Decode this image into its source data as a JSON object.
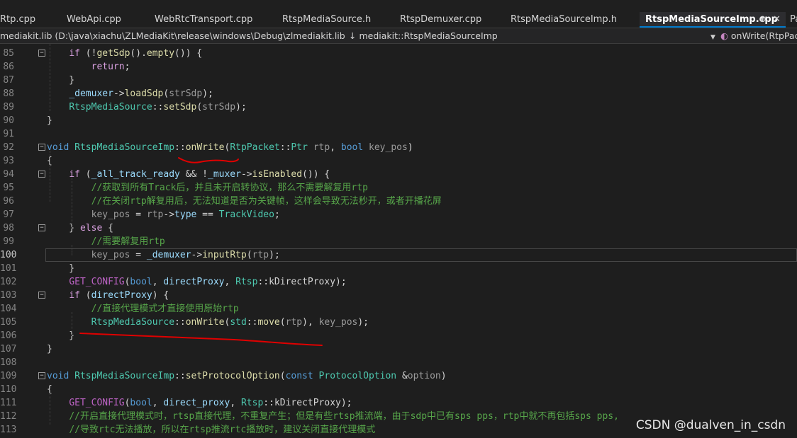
{
  "tabs": [
    {
      "label": "Rtp.cpp",
      "active": false
    },
    {
      "label": "WebApi.cpp",
      "active": false
    },
    {
      "label": "WebRtcTransport.cpp",
      "active": false
    },
    {
      "label": "RtspMediaSource.h",
      "active": false
    },
    {
      "label": "RtspDemuxer.cpp",
      "active": false
    },
    {
      "label": "RtspMediaSourceImp.h",
      "active": false
    },
    {
      "label": "RtspMediaSourceImp.cpp",
      "active": true
    },
    {
      "label": "Pa",
      "active": false
    }
  ],
  "tab_pin": "⊕",
  "tab_close": "✕",
  "navbar": {
    "project": "mediakit.lib (D:\\java\\xiachu\\ZLMediaKit\\release\\windows\\Debug\\zlmediakit.lib) - x",
    "scope_icon": "↓",
    "scope": "mediakit::RtspMediaSourceImp",
    "member_icon": "◐",
    "member": "onWrite(RtpPac"
  },
  "editor": {
    "current_line": 100,
    "lines": [
      {
        "n": "85",
        "fold": "−",
        "t": [
          [
            "    ",
            ""
          ],
          [
            "if",
            "ctl"
          ],
          [
            " (",
            ""
          ],
          [
            "!",
            "pl"
          ],
          [
            "getSdp",
            "fn"
          ],
          [
            "().",
            ""
          ],
          [
            "empty",
            "fn"
          ],
          [
            "()) {",
            ""
          ]
        ]
      },
      {
        "n": "86",
        "t": [
          [
            "        ",
            ""
          ],
          [
            "return",
            "ctl"
          ],
          [
            ";",
            ""
          ]
        ]
      },
      {
        "n": "87",
        "t": [
          [
            "    }",
            ""
          ]
        ]
      },
      {
        "n": "88",
        "t": [
          [
            "    ",
            ""
          ],
          [
            "_demuxer",
            "var"
          ],
          [
            "->",
            ""
          ],
          [
            "loadSdp",
            "fn"
          ],
          [
            "(",
            ""
          ],
          [
            "strSdp",
            "gr"
          ],
          [
            ");",
            ""
          ]
        ]
      },
      {
        "n": "89",
        "t": [
          [
            "    ",
            ""
          ],
          [
            "RtspMediaSource",
            "ty"
          ],
          [
            "::",
            ""
          ],
          [
            "setSdp",
            "fn"
          ],
          [
            "(",
            ""
          ],
          [
            "strSdp",
            "gr"
          ],
          [
            ");",
            ""
          ]
        ]
      },
      {
        "n": "90",
        "t": [
          [
            "}",
            ""
          ]
        ]
      },
      {
        "n": "91",
        "t": []
      },
      {
        "n": "92",
        "fold": "−",
        "t": [
          [
            "void",
            "kw"
          ],
          [
            " ",
            ""
          ],
          [
            "RtspMediaSourceImp",
            "ty"
          ],
          [
            "::",
            ""
          ],
          [
            "onWrite",
            "fn"
          ],
          [
            "(",
            ""
          ],
          [
            "RtpPacket",
            "ty"
          ],
          [
            "::",
            ""
          ],
          [
            "Ptr",
            "ty"
          ],
          [
            " ",
            ""
          ],
          [
            "rtp",
            "gr"
          ],
          [
            ", ",
            ""
          ],
          [
            "bool",
            "kw"
          ],
          [
            " ",
            ""
          ],
          [
            "key_pos",
            "gr"
          ],
          [
            ")",
            ""
          ]
        ]
      },
      {
        "n": "93",
        "t": [
          [
            "{",
            ""
          ]
        ]
      },
      {
        "n": "94",
        "fold": "−",
        "t": [
          [
            "    ",
            ""
          ],
          [
            "if",
            "ctl"
          ],
          [
            " (",
            ""
          ],
          [
            "_all_track_ready",
            "var"
          ],
          [
            " && !",
            ""
          ],
          [
            "_muxer",
            "var"
          ],
          [
            "->",
            ""
          ],
          [
            "isEnabled",
            "fn"
          ],
          [
            "()) {",
            ""
          ]
        ]
      },
      {
        "n": "95",
        "t": [
          [
            "        ",
            ""
          ],
          [
            "//获取到所有Track后，并且未开启转协议，那么不需要解复用rtp",
            "cm"
          ]
        ]
      },
      {
        "n": "96",
        "t": [
          [
            "        ",
            ""
          ],
          [
            "//在关闭rtp解复用后，无法知道是否为关键帧，这样会导致无法秒开，或者开播花屏",
            "cm"
          ]
        ]
      },
      {
        "n": "97",
        "t": [
          [
            "        ",
            ""
          ],
          [
            "key_pos",
            "gr"
          ],
          [
            " = ",
            ""
          ],
          [
            "rtp",
            "gr"
          ],
          [
            "->",
            ""
          ],
          [
            "type",
            "var"
          ],
          [
            " == ",
            ""
          ],
          [
            "TrackVideo",
            "ty"
          ],
          [
            ";",
            ""
          ]
        ]
      },
      {
        "n": "98",
        "fold": "−",
        "t": [
          [
            "    } ",
            ""
          ],
          [
            "else",
            "ctl"
          ],
          [
            " {",
            ""
          ]
        ]
      },
      {
        "n": "99",
        "t": [
          [
            "        ",
            ""
          ],
          [
            "//需要解复用rtp",
            "cm"
          ]
        ]
      },
      {
        "n": "100",
        "t": [
          [
            "        ",
            ""
          ],
          [
            "key_pos",
            "gr"
          ],
          [
            " = ",
            ""
          ],
          [
            "_demuxer",
            "var"
          ],
          [
            "->",
            ""
          ],
          [
            "inputRtp",
            "fn"
          ],
          [
            "(",
            ""
          ],
          [
            "rtp",
            "gr"
          ],
          [
            ");",
            ""
          ]
        ]
      },
      {
        "n": "101",
        "t": [
          [
            "    }",
            ""
          ]
        ]
      },
      {
        "n": "102",
        "t": [
          [
            "    ",
            ""
          ],
          [
            "GET_CONFIG",
            "mac"
          ],
          [
            "(",
            ""
          ],
          [
            "bool",
            "kw"
          ],
          [
            ", ",
            ""
          ],
          [
            "directProxy",
            "var"
          ],
          [
            ", ",
            ""
          ],
          [
            "Rtsp",
            "ty"
          ],
          [
            "::",
            ""
          ],
          [
            "kDirectProxy",
            "pl"
          ],
          [
            ");",
            ""
          ]
        ]
      },
      {
        "n": "103",
        "fold": "−",
        "t": [
          [
            "    ",
            ""
          ],
          [
            "if",
            "ctl"
          ],
          [
            " (",
            ""
          ],
          [
            "directProxy",
            "var"
          ],
          [
            ") {",
            ""
          ]
        ]
      },
      {
        "n": "104",
        "t": [
          [
            "        ",
            ""
          ],
          [
            "//直接代理模式才直接使用原始rtp",
            "cm"
          ]
        ]
      },
      {
        "n": "105",
        "t": [
          [
            "        ",
            ""
          ],
          [
            "RtspMediaSource",
            "ty"
          ],
          [
            "::",
            ""
          ],
          [
            "onWrite",
            "fn"
          ],
          [
            "(",
            ""
          ],
          [
            "std",
            "ty"
          ],
          [
            "::",
            ""
          ],
          [
            "move",
            "fn"
          ],
          [
            "(",
            ""
          ],
          [
            "rtp",
            "gr"
          ],
          [
            "), ",
            ""
          ],
          [
            "key_pos",
            "gr"
          ],
          [
            ");",
            ""
          ]
        ]
      },
      {
        "n": "106",
        "t": [
          [
            "    }",
            ""
          ]
        ]
      },
      {
        "n": "107",
        "t": [
          [
            "}",
            ""
          ]
        ]
      },
      {
        "n": "108",
        "t": []
      },
      {
        "n": "109",
        "fold": "−",
        "t": [
          [
            "void",
            "kw"
          ],
          [
            " ",
            ""
          ],
          [
            "RtspMediaSourceImp",
            "ty"
          ],
          [
            "::",
            ""
          ],
          [
            "setProtocolOption",
            "fn"
          ],
          [
            "(",
            ""
          ],
          [
            "const",
            "kw"
          ],
          [
            " ",
            ""
          ],
          [
            "ProtocolOption",
            "ty"
          ],
          [
            " &",
            ""
          ],
          [
            "option",
            "gr"
          ],
          [
            ")",
            ""
          ]
        ]
      },
      {
        "n": "110",
        "t": [
          [
            "{",
            ""
          ]
        ]
      },
      {
        "n": "111",
        "t": [
          [
            "    ",
            ""
          ],
          [
            "GET_CONFIG",
            "mac"
          ],
          [
            "(",
            ""
          ],
          [
            "bool",
            "kw"
          ],
          [
            ", ",
            ""
          ],
          [
            "direct_proxy",
            "var"
          ],
          [
            ", ",
            ""
          ],
          [
            "Rtsp",
            "ty"
          ],
          [
            "::",
            ""
          ],
          [
            "kDirectProxy",
            "pl"
          ],
          [
            ");",
            ""
          ]
        ]
      },
      {
        "n": "112",
        "t": [
          [
            "    ",
            ""
          ],
          [
            "//开启直接代理模式时，rtsp直接代理，不重复产生；但是有些rtsp推流端，由于sdp中已有sps pps，rtp中就不再包括sps pps,",
            "cm"
          ]
        ]
      },
      {
        "n": "113",
        "t": [
          [
            "    ",
            ""
          ],
          [
            "//导致rtc无法播放，所以在rtsp推流rtc播放时，建议关闭直接代理模式",
            "cm"
          ]
        ]
      }
    ]
  },
  "watermark": "CSDN @dualven_in_csdn",
  "colors": {
    "annotation_ink": "#e00000",
    "accent": "#007acc"
  }
}
